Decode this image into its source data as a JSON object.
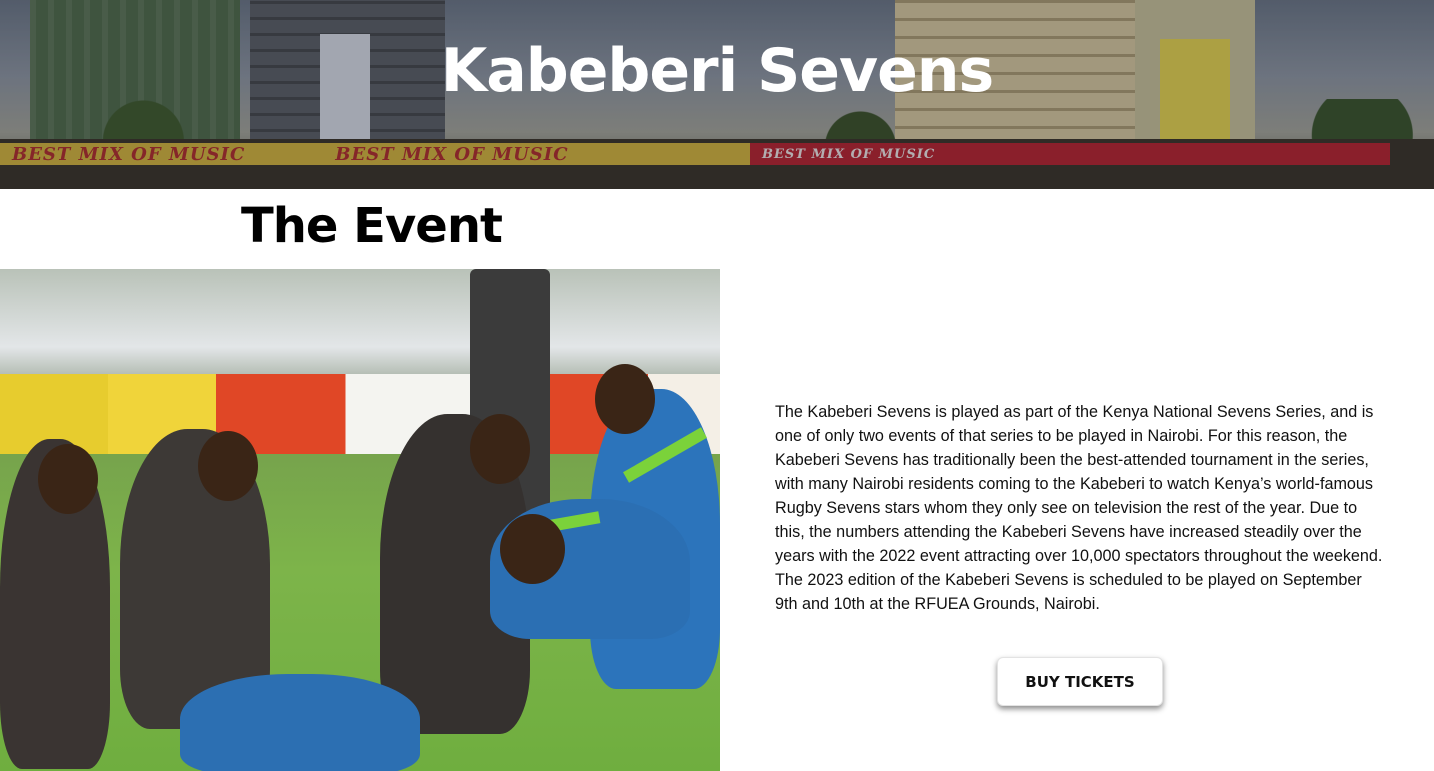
{
  "hero": {
    "title": "Kabeberi Sevens",
    "banner_text_1": "BEST MIX OF MUSIC",
    "banner_text_2": "BEST MIX OF MUSIC",
    "banner_text_3": "BEST MIX OF MUSIC"
  },
  "event": {
    "heading": "The Event",
    "description": "The Kabeberi Sevens is played as part of the Kenya National Sevens Series, and is one of only two events of that series to be played in Nairobi. For this reason, the Kabeberi Sevens has traditionally been the best-attended tournament in the series, with many Nairobi residents coming to the Kabeberi to watch Kenya’s world-famous Rugby Sevens stars whom they only see on television the rest of the year. Due to this, the numbers attending the Kabeberi Sevens have increased steadily over the years with the 2022 event attracting over 10,000 spectators throughout the weekend. The 2023 edition of the Kabeberi Sevens is scheduled to be played on September 9th and 10th at the RFUEA Grounds, Nairobi.",
    "cta_label": "BUY TICKETS"
  }
}
